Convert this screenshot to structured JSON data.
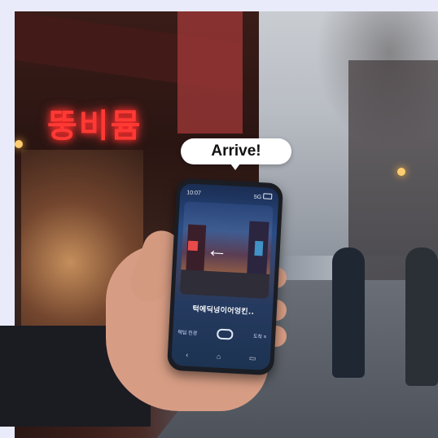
{
  "scene": {
    "neon_sign": "뚱비뮴"
  },
  "bubble": {
    "text": "Arrive!"
  },
  "phone": {
    "status_left": "10:07",
    "status_right": "5G",
    "arrow_icon": "arrow-left-icon",
    "route_text": "턱에딕넝이어엉킨..",
    "bottom_left_label": "택딥 진경",
    "bottom_right_label": "도착 ≡",
    "nav_keys": [
      "‹",
      "⌂",
      "▭"
    ]
  },
  "colors": {
    "neon_red": "#ff3a35",
    "bubble_bg": "#ffffff",
    "frame_bg": "#e9ebfb"
  }
}
